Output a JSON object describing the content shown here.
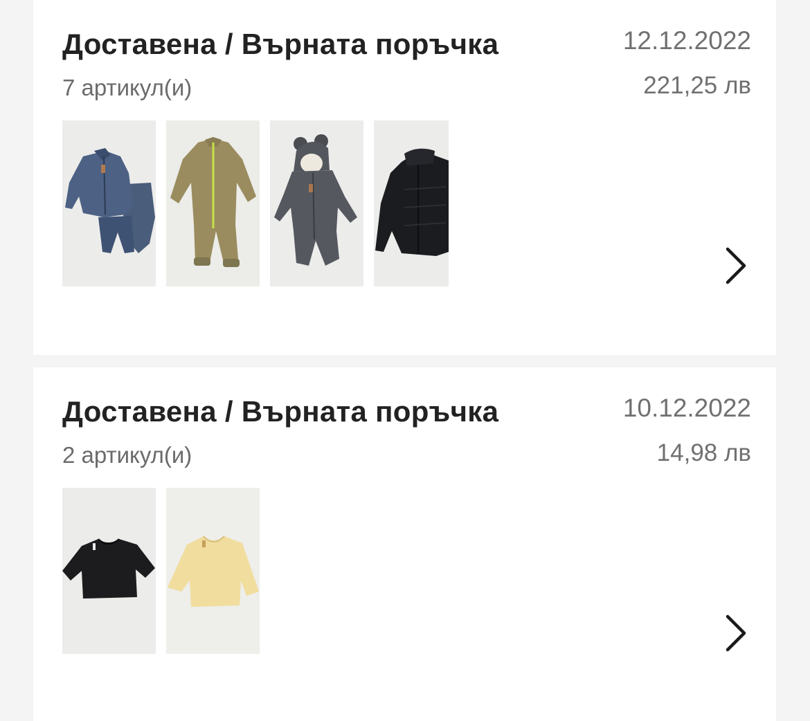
{
  "orders": [
    {
      "status": "Доставена / Върната поръчка",
      "items_count": "7 артикул(и)",
      "date": "12.12.2022",
      "total": "221,25 лв",
      "thumbnails": [
        "blue-knit-jacket-set-icon",
        "olive-fleece-jumpsuit-icon",
        "grey-hooded-bear-jumpsuit-icon",
        "black-quilted-jacket-icon"
      ],
      "open_icon": "chevron-right-icon"
    },
    {
      "status": "Доставена / Върната поръчка",
      "items_count": "2 артикул(и)",
      "date": "10.12.2022",
      "total": "14,98 лв",
      "thumbnails": [
        "black-crop-tshirt-icon",
        "yellow-crop-tshirt-icon"
      ],
      "open_icon": "chevron-right-icon"
    }
  ],
  "colors": {
    "background": "#f4f4f4",
    "card": "#ffffff",
    "title": "#222222",
    "meta": "#707070",
    "thumb_bg": "#ececeb"
  }
}
